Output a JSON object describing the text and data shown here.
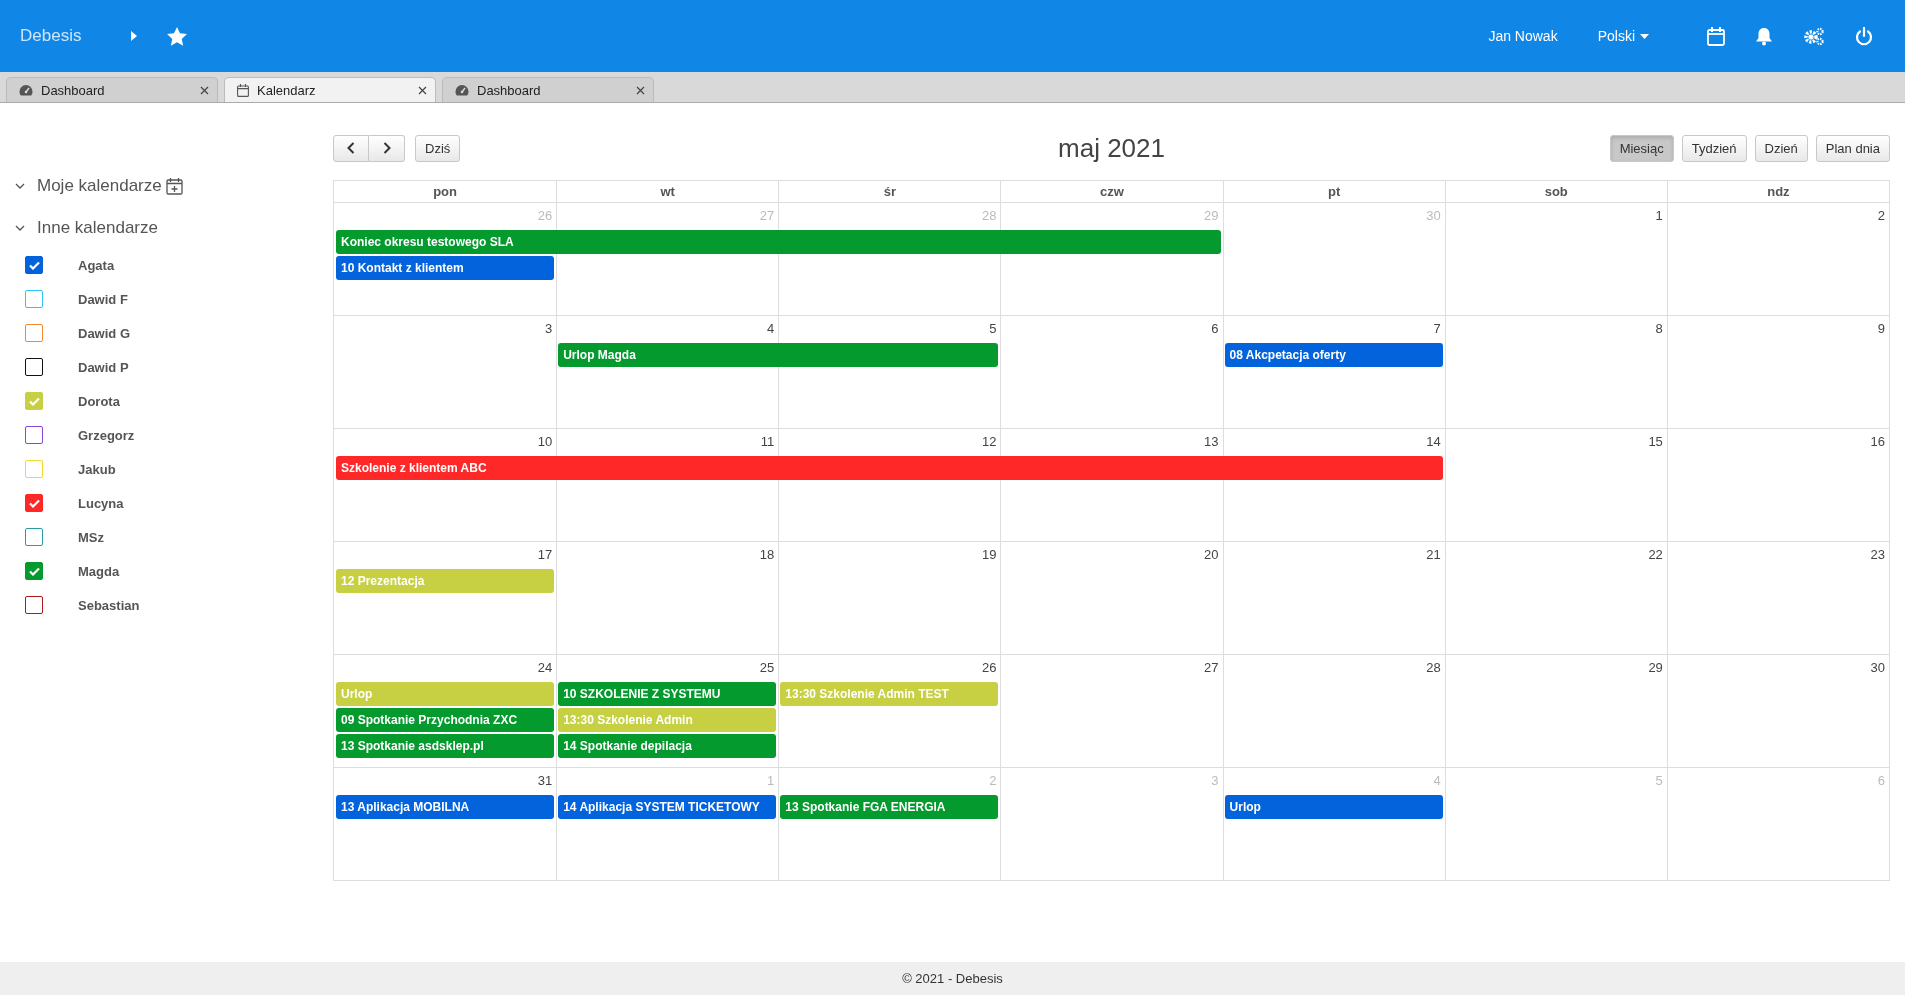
{
  "header": {
    "brand": "Debesis",
    "user": "Jan Nowak",
    "language": "Polski"
  },
  "tabs": [
    {
      "label": "Dashboard",
      "kind": "dashboard",
      "selected": false
    },
    {
      "label": "Kalendarz",
      "kind": "calendar",
      "selected": true
    },
    {
      "label": "Dashboard",
      "kind": "dashboard",
      "selected": false
    }
  ],
  "sidebar": {
    "sections": [
      {
        "title": "Moje kalendarze",
        "expanded": true,
        "add_icon": true
      },
      {
        "title": "Inne kalendarze",
        "expanded": true,
        "add_icon": false
      }
    ],
    "calendars": [
      {
        "name": "Agata",
        "color": "#0363dc",
        "checked": true
      },
      {
        "name": "Dawid F",
        "color": "#2bc4f5",
        "checked": false
      },
      {
        "name": "Dawid G",
        "color": "#f08a2c",
        "checked": false
      },
      {
        "name": "Dawid P",
        "color": "#111111",
        "checked": false
      },
      {
        "name": "Dorota",
        "color": "#c7cf42",
        "checked": true
      },
      {
        "name": "Grzegorz",
        "color": "#8a44d6",
        "checked": false
      },
      {
        "name": "Jakub",
        "color": "#f5d92c",
        "checked": false
      },
      {
        "name": "Lucyna",
        "color": "#ff2828",
        "checked": true
      },
      {
        "name": "MSz",
        "color": "#2a9ca5",
        "checked": false
      },
      {
        "name": "Magda",
        "color": "#049a2e",
        "checked": true
      },
      {
        "name": "Sebastian",
        "color": "#b01818",
        "checked": false
      }
    ]
  },
  "toolbar": {
    "today": "Dziś",
    "title": "maj 2021",
    "views": [
      {
        "label": "Miesiąc",
        "selected": true
      },
      {
        "label": "Tydzień",
        "selected": false
      },
      {
        "label": "Dzień",
        "selected": false
      },
      {
        "label": "Plan dnia",
        "selected": false
      }
    ]
  },
  "weekdays": [
    "pon",
    "wt",
    "śr",
    "czw",
    "pt",
    "sob",
    "ndz"
  ],
  "weeks": [
    {
      "days": [
        {
          "label": "26",
          "other_month": true,
          "events": [
            {
              "kind": "start",
              "title": "Koniec okresu testowego SLA",
              "color": "#049a2e"
            },
            {
              "kind": "start",
              "title": "10 Kontakt z klientem",
              "color": "#0363dc"
            }
          ]
        },
        {
          "label": "27",
          "other_month": true,
          "events": [
            {
              "kind": "continued"
            }
          ]
        },
        {
          "label": "28",
          "other_month": true,
          "events": [
            {
              "kind": "continued"
            }
          ]
        },
        {
          "label": "29",
          "other_month": true,
          "events": [
            {
              "kind": "continued"
            }
          ]
        },
        {
          "label": "30",
          "other_month": true
        },
        {
          "label": "1",
          "other_month": false
        },
        {
          "label": "2",
          "other_month": false
        }
      ]
    },
    {
      "days": [
        {
          "label": "3",
          "other_month": false
        },
        {
          "label": "4",
          "other_month": false,
          "events": [
            {
              "kind": "start",
              "title": "Urlop Magda",
              "color": "#049a2e"
            }
          ]
        },
        {
          "label": "5",
          "other_month": false,
          "events": [
            {
              "kind": "continued"
            }
          ]
        },
        {
          "label": "6",
          "other_month": false
        },
        {
          "label": "7",
          "other_month": false,
          "events": [
            {
              "kind": "start",
              "title": "08 Akcpetacja oferty",
              "color": "#0363dc"
            }
          ]
        },
        {
          "label": "8",
          "other_month": false
        },
        {
          "label": "9",
          "other_month": false
        }
      ]
    },
    {
      "days": [
        {
          "label": "10",
          "other_month": false,
          "events": [
            {
              "kind": "start",
              "title": "Szkolenie z klientem ABC",
              "color": "#ff2828"
            }
          ]
        },
        {
          "label": "11",
          "other_month": false,
          "events": [
            {
              "kind": "continued"
            }
          ]
        },
        {
          "label": "12",
          "other_month": false,
          "events": [
            {
              "kind": "continued"
            }
          ]
        },
        {
          "label": "13",
          "other_month": false,
          "events": [
            {
              "kind": "continued"
            }
          ]
        },
        {
          "label": "14",
          "other_month": false,
          "events": [
            {
              "kind": "continued"
            }
          ]
        },
        {
          "label": "15",
          "other_month": false
        },
        {
          "label": "16",
          "other_month": false
        }
      ]
    },
    {
      "days": [
        {
          "label": "17",
          "other_month": false,
          "events": [
            {
              "kind": "start",
              "title": "12 Prezentacja",
              "color": "#c7cf42"
            }
          ]
        },
        {
          "label": "18",
          "other_month": false
        },
        {
          "label": "19",
          "other_month": false
        },
        {
          "label": "20",
          "other_month": false
        },
        {
          "label": "21",
          "other_month": false
        },
        {
          "label": "22",
          "other_month": false
        },
        {
          "label": "23",
          "other_month": false
        }
      ]
    },
    {
      "days": [
        {
          "label": "24",
          "other_month": false,
          "events": [
            {
              "kind": "start",
              "title": "Urlop",
              "color": "#c7cf42"
            },
            {
              "kind": "start",
              "title": "09 Spotkanie Przychodnia ZXC",
              "color": "#049a2e"
            },
            {
              "kind": "start",
              "title": "13 Spotkanie asdsklep.pl",
              "color": "#049a2e"
            }
          ]
        },
        {
          "label": "25",
          "other_month": false,
          "events": [
            {
              "kind": "start",
              "title": "10 SZKOLENIE Z SYSTEMU",
              "color": "#049a2e"
            },
            {
              "kind": "start",
              "title": "13:30 Szkolenie Admin",
              "color": "#c7cf42"
            },
            {
              "kind": "start",
              "title": "14 Spotkanie depilacja",
              "color": "#049a2e"
            }
          ]
        },
        {
          "label": "26",
          "other_month": false,
          "events": [
            {
              "kind": "start",
              "title": "13:30 Szkolenie Admin TEST",
              "color": "#c7cf42"
            }
          ]
        },
        {
          "label": "27",
          "other_month": false
        },
        {
          "label": "28",
          "other_month": false
        },
        {
          "label": "29",
          "other_month": false
        },
        {
          "label": "30",
          "other_month": false
        }
      ]
    },
    {
      "days": [
        {
          "label": "31",
          "other_month": false,
          "events": [
            {
              "kind": "start",
              "title": "13 Aplikacja MOBILNA",
              "color": "#0363dc"
            }
          ]
        },
        {
          "label": "1",
          "other_month": true,
          "events": [
            {
              "kind": "start",
              "title": "14 Aplikacja SYSTEM TICKETOWY",
              "color": "#0363dc"
            }
          ]
        },
        {
          "label": "2",
          "other_month": true,
          "events": [
            {
              "kind": "start",
              "title": "13 Spotkanie FGA ENERGIA",
              "color": "#049a2e"
            }
          ]
        },
        {
          "label": "3",
          "other_month": true
        },
        {
          "label": "4",
          "other_month": true,
          "events": [
            {
              "kind": "start",
              "title": "Urlop",
              "color": "#0363dc"
            }
          ]
        },
        {
          "label": "5",
          "other_month": true
        },
        {
          "label": "6",
          "other_month": true
        }
      ]
    }
  ],
  "footer": "© 2021 - Debesis"
}
